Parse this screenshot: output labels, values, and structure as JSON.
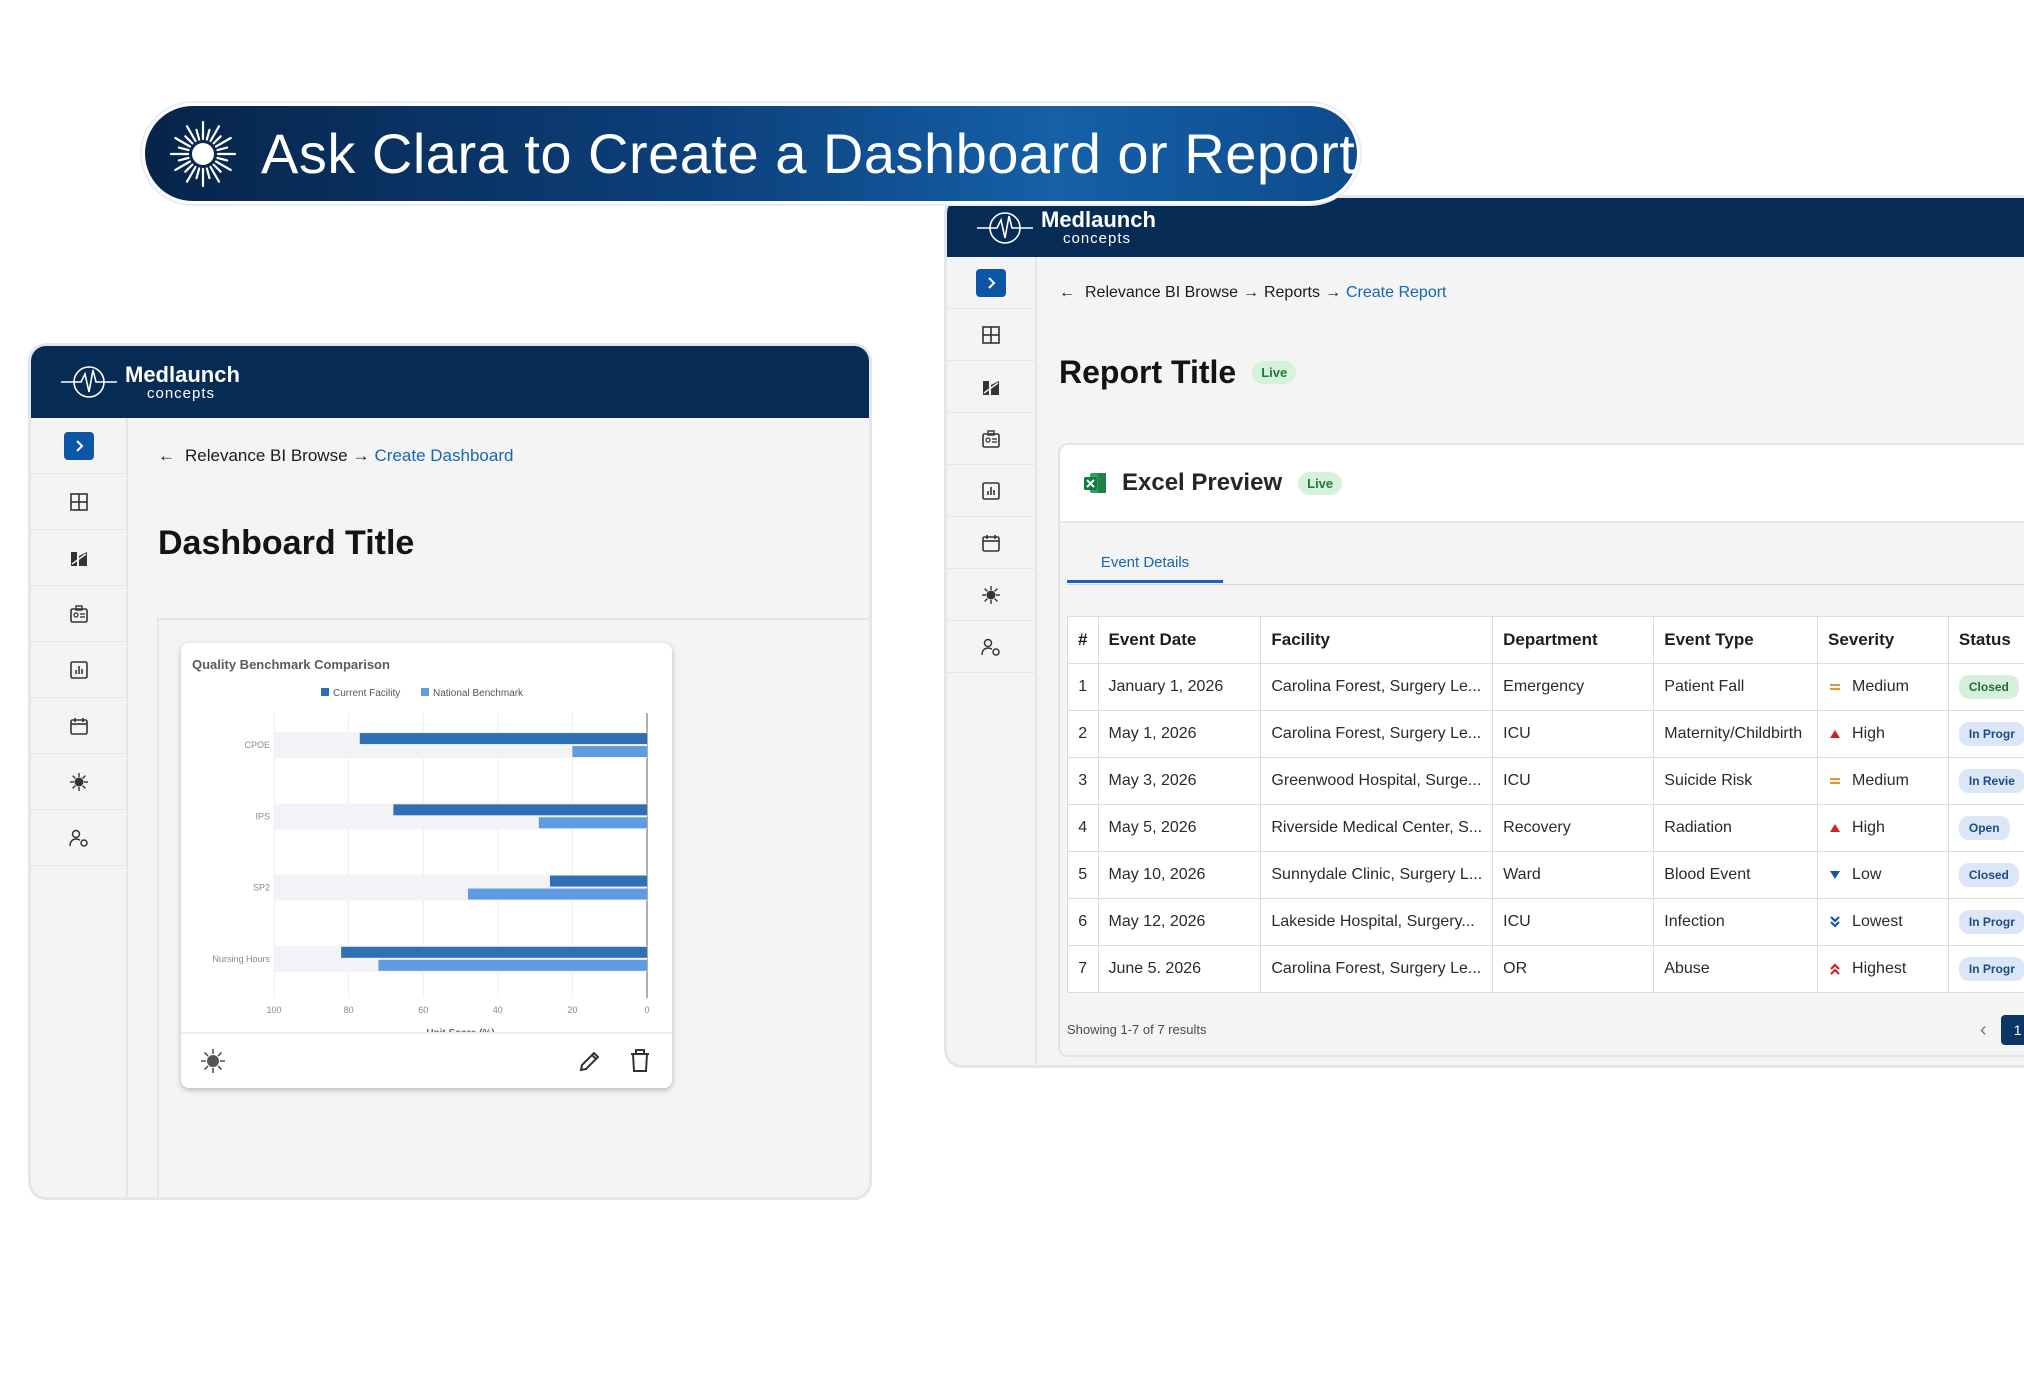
{
  "banner": {
    "text": "Ask Clara to Create a Dashboard or Report",
    "icon": "sunburst-icon"
  },
  "brand": {
    "name": "Medlaunch",
    "sub": "concepts"
  },
  "colors": {
    "navy": "#062b55",
    "accent": "#1566b5",
    "live_bg": "#d7f2dc",
    "bar_current": "#2f6fb3",
    "bar_national": "#5e9be0"
  },
  "dashboard": {
    "crumb_root": "Relevance BI Browse",
    "crumb_sep": "→",
    "crumb_current": "Create Dashboard",
    "title": "Dashboard Title"
  },
  "chart_data": {
    "type": "bar",
    "title": "Quality Benchmark Comparison",
    "categories": [
      "CPOE",
      "IPS",
      "SP2",
      "Nursing Hours"
    ],
    "series": [
      {
        "name": "Current Facility",
        "values": [
          77,
          68,
          26,
          82
        ]
      },
      {
        "name": "National Benchmark",
        "values": [
          20,
          29,
          48,
          72
        ]
      }
    ],
    "xlabel": "Unit Score (%)",
    "ylabel": "",
    "xlim": [
      100,
      0
    ],
    "xticks": [
      "100",
      "80",
      "60",
      "40",
      "20",
      "0"
    ],
    "legend": "top",
    "grid": true
  },
  "report": {
    "crumb_root": "Relevance BI Browse",
    "crumb_sep1": "→",
    "crumb_mid": "Reports",
    "crumb_sep2": "→",
    "crumb_current": "Create Report",
    "title": "Report Title",
    "live": "Live",
    "preview_title": "Excel Preview",
    "preview_live": "Live",
    "tab": "Event Details",
    "columns": [
      "#",
      "Event Date",
      "Facility",
      "Department",
      "Event Type",
      "Severity",
      "Status"
    ],
    "rows": [
      {
        "n": "1",
        "date": "January 1, 2026",
        "facility": "Carolina Forest, Surgery Le...",
        "dept": "Emergency",
        "type": "Patient Fall",
        "severity": "Medium",
        "sev_icon": "equals-icon",
        "status": "Closed",
        "status_kind": "closed"
      },
      {
        "n": "2",
        "date": "May 1, 2026",
        "facility": "Carolina Forest, Surgery Le...",
        "dept": "ICU",
        "type": "Maternity/Childbirth",
        "severity": "High",
        "sev_icon": "triangle-up-icon",
        "status": "In Progr",
        "status_kind": "blue"
      },
      {
        "n": "3",
        "date": "May 3, 2026",
        "facility": "Greenwood Hospital, Surge...",
        "dept": "ICU",
        "type": "Suicide Risk",
        "severity": "Medium",
        "sev_icon": "equals-icon",
        "status": "In Revie",
        "status_kind": "blue"
      },
      {
        "n": "4",
        "date": "May 5, 2026",
        "facility": "Riverside Medical Center, S...",
        "dept": "Recovery",
        "type": "Radiation",
        "severity": "High",
        "sev_icon": "triangle-up-icon",
        "status": "Open",
        "status_kind": "blue"
      },
      {
        "n": "5",
        "date": "May 10, 2026",
        "facility": "Sunnydale Clinic, Surgery L...",
        "dept": "Ward",
        "type": "Blood Event",
        "severity": "Low",
        "sev_icon": "triangle-down-icon",
        "status": "Closed",
        "status_kind": "blue"
      },
      {
        "n": "6",
        "date": "May 12, 2026",
        "facility": "Lakeside Hospital, Surgery...",
        "dept": "ICU",
        "type": "Infection",
        "severity": "Lowest",
        "sev_icon": "double-chevron-down-icon",
        "status": "In Progr",
        "status_kind": "blue"
      },
      {
        "n": "7",
        "date": "June 5. 2026",
        "facility": "Carolina Forest, Surgery Le...",
        "dept": "OR",
        "type": "Abuse",
        "severity": "Highest",
        "sev_icon": "double-chevron-up-icon",
        "status": "In Progr",
        "status_kind": "blue"
      }
    ],
    "footer": "Showing 1-7 of 7 results",
    "page": "1"
  }
}
